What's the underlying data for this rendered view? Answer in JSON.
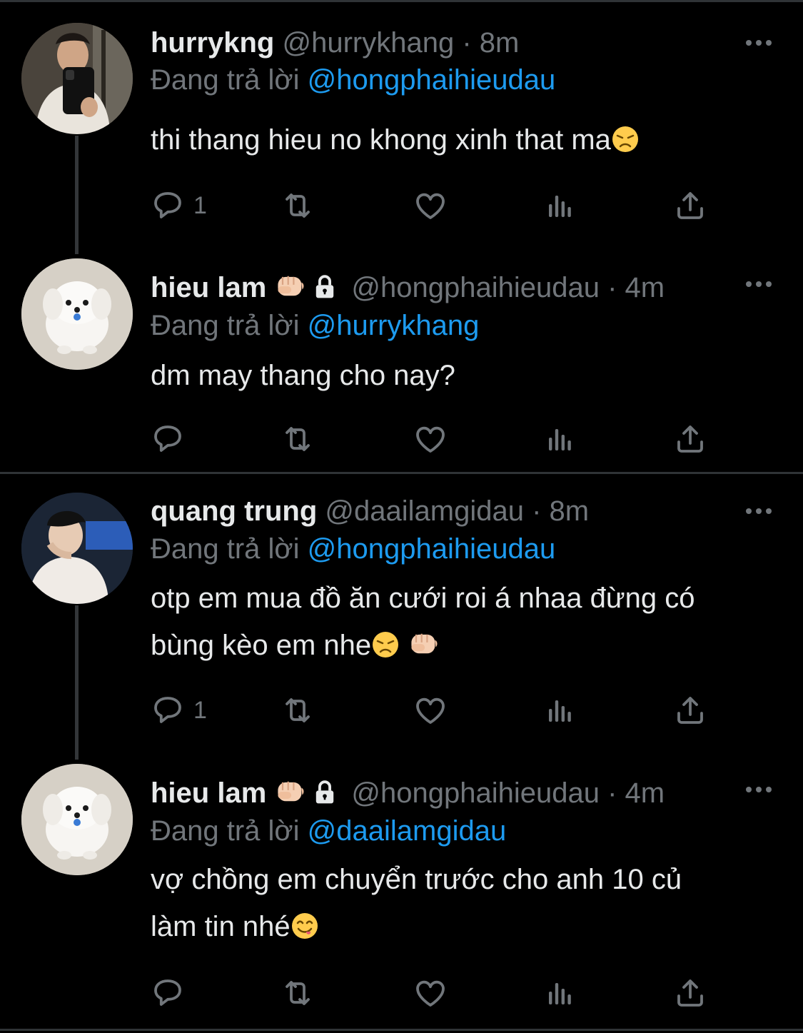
{
  "tweets": [
    {
      "name": "hurrykng",
      "handle": "@hurrykhang",
      "time": "· 8m",
      "replying_prefix": "Đang trả lời",
      "replying_to": "@hongphaihieudau",
      "text": "thi thang hieu no khong xinh that ma",
      "text_emoji": "disappointed-face",
      "reply_count": "1"
    },
    {
      "name": "hieu lam",
      "name_emoji": "fist",
      "locked": true,
      "handle": "@hongphaihieudau",
      "time": "· 4m",
      "replying_prefix": "Đang trả lời",
      "replying_to": "@hurrykhang",
      "text": "dm may thang cho nay?",
      "reply_count": ""
    },
    {
      "name": "quang trung",
      "handle": "@daailamgidau",
      "time": "· 8m",
      "replying_prefix": "Đang trả lời",
      "replying_to": "@hongphaihieudau",
      "text_line1": "otp em mua đồ ăn cưới roi á nhaa đừng có",
      "text_line2": "bùng kèo em nhe",
      "text_emoji": "disappointed-face fist",
      "reply_count": "1"
    },
    {
      "name": "hieu lam",
      "name_emoji": "fist",
      "locked": true,
      "handle": "@hongphaihieudau",
      "time": "· 4m",
      "replying_prefix": "Đang trả lời",
      "replying_to": "@daailamgidau",
      "text_line1": "vợ chồng em chuyển trước cho anh 10 củ",
      "text_line2": "làm tin nhé",
      "text_emoji": "yum-face",
      "reply_count": ""
    }
  ],
  "colors": {
    "background": "#000000",
    "text": "#e7e9ea",
    "muted": "#71767b",
    "link": "#1d9bf0",
    "divider": "#2f3336"
  },
  "icons": [
    "reply-icon",
    "retweet-icon",
    "like-icon",
    "views-icon",
    "share-icon",
    "more-icon",
    "lock-icon"
  ]
}
